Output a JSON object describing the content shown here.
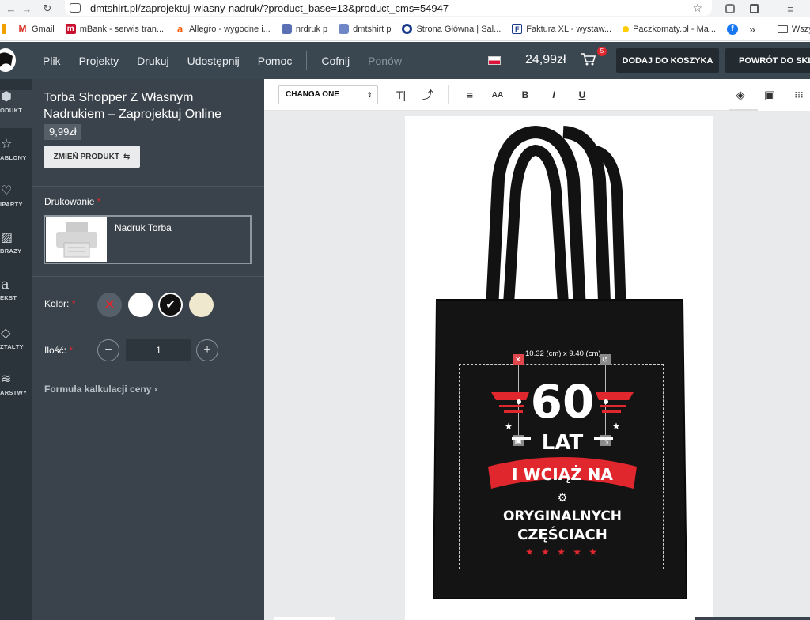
{
  "browser": {
    "url": "dmtshirt.pl/zaprojektuj-wlasny-nadruk/?product_base=13&product_cms=54947",
    "bookmarks": [
      "Gmail",
      "mBank - serwis tran...",
      "Allegro - wygodne i...",
      "nrdruk p",
      "dmtshirt p",
      "Strona Główna | Sal...",
      "Faktura XL - wystaw...",
      "Paczkomaty.pl - Ma..."
    ],
    "bookmarks_overflow": "»",
    "all_bookmarks": "Wszystkie"
  },
  "topbar": {
    "menu": [
      "Plik",
      "Projekty",
      "Drukuj",
      "Udostępnij",
      "Pomoc"
    ],
    "undo": "Cofnij",
    "redo": "Ponów",
    "price": "24,99zł",
    "cart_count": "5",
    "add_to_cart": "DODAJ DO KOSZYKA",
    "back_to_shop": "POWRÓT DO SKL"
  },
  "sidebar": {
    "items": [
      "ODUKT",
      "ABLONY",
      "IPARTY",
      "BRAZY",
      "EKST",
      "ZTAŁTY",
      "ARSTWY"
    ]
  },
  "product": {
    "title": "Torba Shopper Z Własnym Nadrukiem – Zaprojektuj Online",
    "price": "9,99zł",
    "change_button": "ZMIEŃ PRODUKT",
    "printing_label": "Drukowanie",
    "printing_option": "Nadruk Torba",
    "color_label": "Kolor:",
    "colors": [
      "#ffffff",
      "#111111",
      "#efe8cf"
    ],
    "selected_color": "#111111",
    "qty_label": "Ilość:",
    "quantity": "1",
    "price_formula": "Formuła kalkulacji ceny",
    "required_mark": "*"
  },
  "toolbar": {
    "font_name": "CHANGA ONE",
    "tools": [
      "T⃒",
      "A",
      "B",
      "I",
      "U"
    ]
  },
  "design": {
    "dimension": "10.32 (cm) x 9.40 (cm)",
    "number": "60",
    "line2": "LAT",
    "banner": "I WCIĄŻ NA",
    "line4": "ORYGINALNYCH",
    "line5": "CZĘŚCIACH",
    "accent": "#e0272e"
  }
}
